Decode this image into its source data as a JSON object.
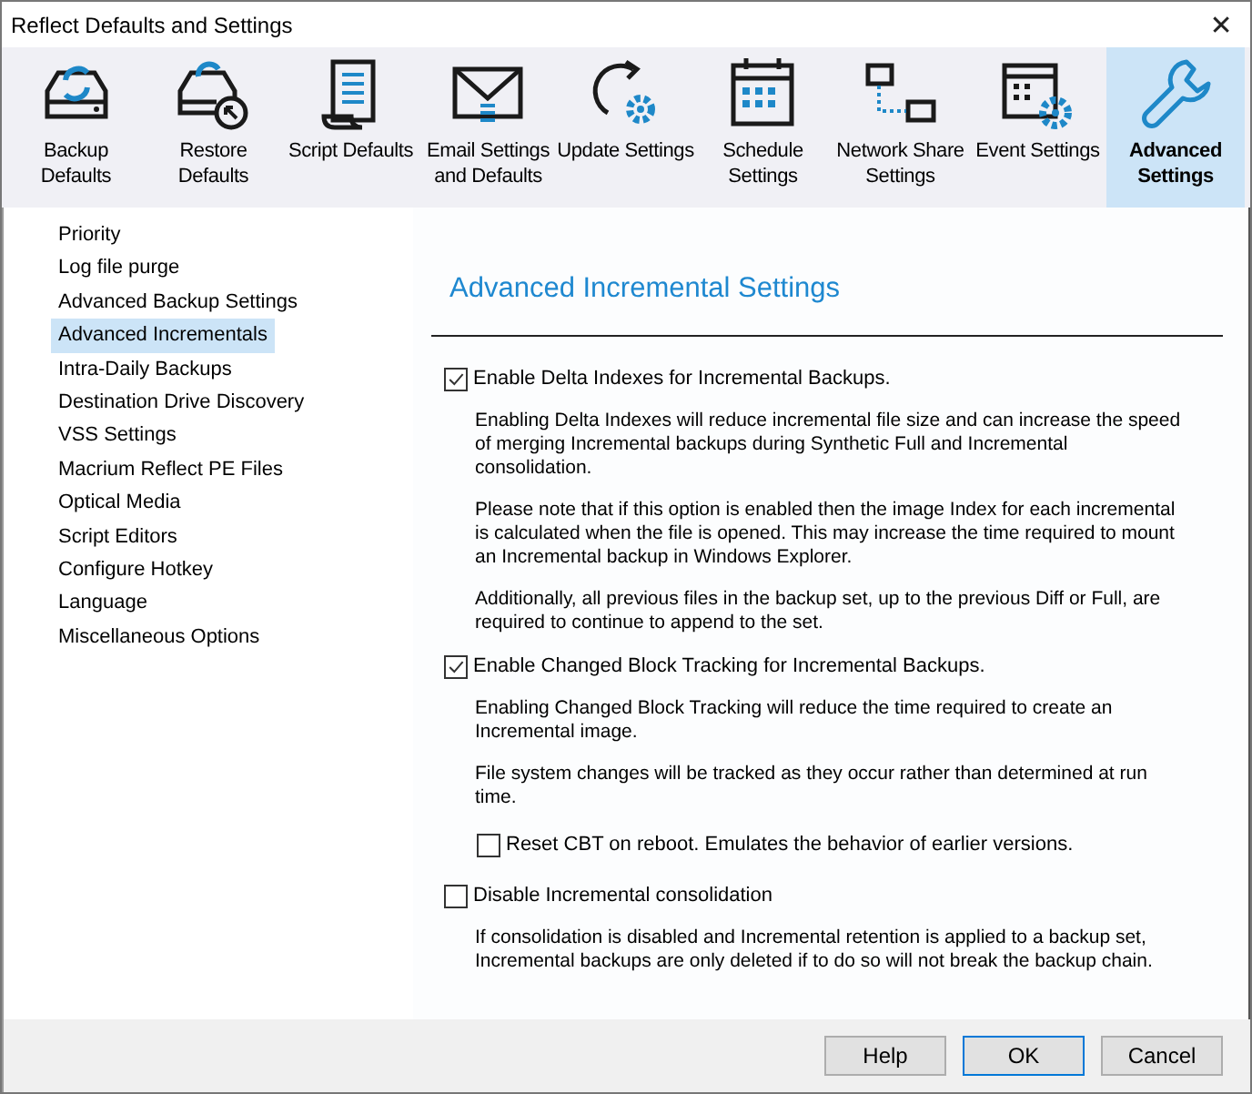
{
  "window": {
    "title": "Reflect Defaults and Settings",
    "close": "✕"
  },
  "toolbar": [
    {
      "label": "Backup Defaults",
      "selected": false
    },
    {
      "label": "Restore Defaults",
      "selected": false
    },
    {
      "label": "Script Defaults",
      "selected": false
    },
    {
      "label": "Email Settings and Defaults",
      "selected": false
    },
    {
      "label": "Update Settings",
      "selected": false
    },
    {
      "label": "Schedule Settings",
      "selected": false
    },
    {
      "label": "Network Share Settings",
      "selected": false
    },
    {
      "label": "Event Settings",
      "selected": false
    },
    {
      "label": "Advanced Settings",
      "selected": true
    }
  ],
  "sidebar": {
    "items": [
      {
        "label": "Priority",
        "selected": false
      },
      {
        "label": "Log file purge",
        "selected": false
      },
      {
        "label": "Advanced Backup Settings",
        "selected": false
      },
      {
        "label": "Advanced Incrementals",
        "selected": true
      },
      {
        "label": "Intra-Daily Backups",
        "selected": false
      },
      {
        "label": "Destination Drive Discovery",
        "selected": false
      },
      {
        "label": "VSS Settings",
        "selected": false
      },
      {
        "label": "Macrium Reflect PE Files",
        "selected": false
      },
      {
        "label": "Optical Media",
        "selected": false
      },
      {
        "label": "Script Editors",
        "selected": false
      },
      {
        "label": "Configure Hotkey",
        "selected": false
      },
      {
        "label": "Language",
        "selected": false
      },
      {
        "label": "Miscellaneous Options",
        "selected": false
      }
    ]
  },
  "panel": {
    "heading": "Advanced Incremental Settings",
    "options": [
      {
        "label": "Enable Delta Indexes for Incremental Backups.",
        "checked": true,
        "notes": [
          "Enabling Delta Indexes will reduce incremental file size and can increase the speed of merging Incremental backups during Synthetic Full and Incremental consolidation.",
          "Please note that if this option is enabled then the image Index for each incremental is calculated when the file is opened. This may increase the time required to mount an Incremental backup in Windows Explorer.",
          "Additionally, all previous files in the backup set, up to the previous Diff or Full, are required to continue to append to the set."
        ]
      },
      {
        "label": "Enable Changed Block Tracking for Incremental Backups.",
        "checked": true,
        "notes": [
          "Enabling Changed Block Tracking will reduce the time required to create an Incremental image.",
          "File system changes will be tracked as they occur rather than determined at run time."
        ],
        "suboptions": [
          {
            "label": "Reset CBT on reboot.  Emulates the behavior of earlier versions.",
            "checked": false
          }
        ]
      },
      {
        "label": "Disable Incremental consolidation",
        "checked": false,
        "notes": [
          "If consolidation is disabled and Incremental retention is applied to a backup set, Incremental backups are only deleted if to do so will not break the backup chain."
        ]
      }
    ]
  },
  "buttons": [
    {
      "label": "Help",
      "default": false
    },
    {
      "label": "OK",
      "default": true
    },
    {
      "label": "Cancel",
      "default": false
    }
  ]
}
